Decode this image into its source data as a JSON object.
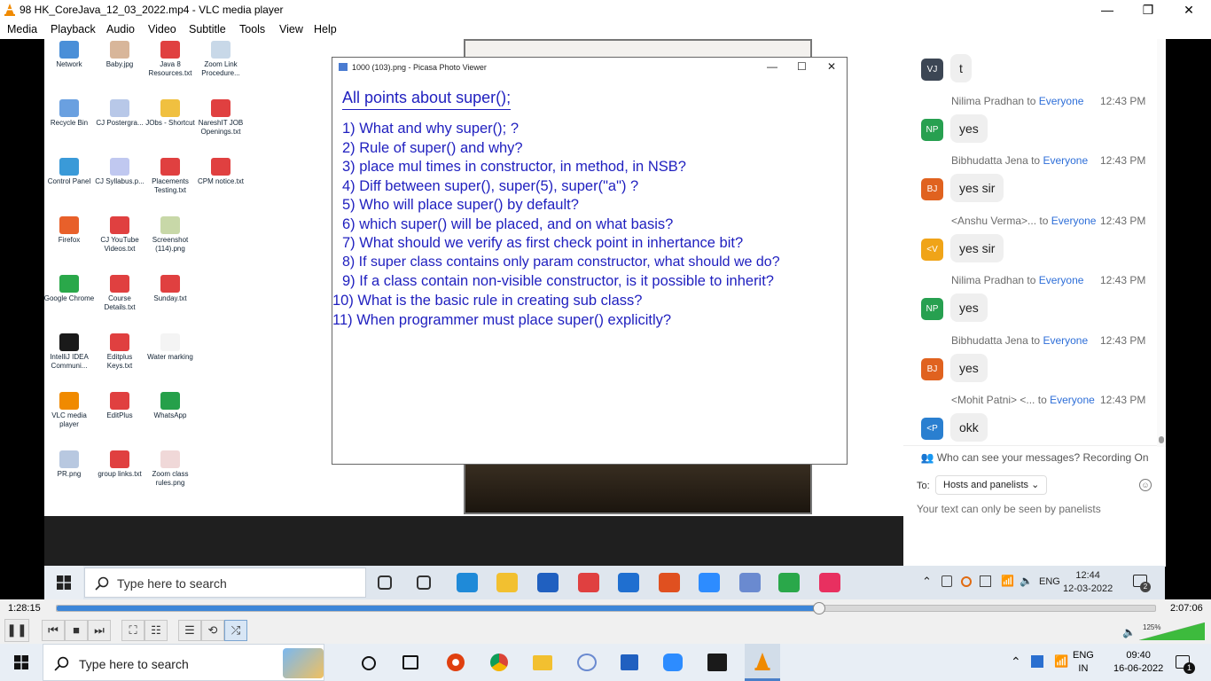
{
  "window": {
    "title": "98 HK_CoreJava_12_03_2022.mp4 - VLC media player",
    "controls": {
      "minimize": "—",
      "restore": "❐",
      "close": "✕"
    }
  },
  "menu": [
    "Media",
    "Playback",
    "Audio",
    "Video",
    "Subtitle",
    "Tools",
    "View",
    "Help"
  ],
  "desktop_icons": [
    {
      "label": "Network",
      "color": "#4a8fd8"
    },
    {
      "label": "Baby.jpg",
      "color": "#d8b69a"
    },
    {
      "label": "Java 8 Resources.txt",
      "color": "#e04040"
    },
    {
      "label": "Zoom Link Procedure...",
      "color": "#c8d8e8"
    },
    {
      "label": "Recycle Bin",
      "color": "#6aa0e0"
    },
    {
      "label": "CJ Postergra...",
      "color": "#b8c8e8"
    },
    {
      "label": "JObs - Shortcut",
      "color": "#f0c040"
    },
    {
      "label": "NareshIT JOB Openings.txt",
      "color": "#e04040"
    },
    {
      "label": "Control Panel",
      "color": "#3a9ad8"
    },
    {
      "label": "CJ Syllabus.p...",
      "color": "#c0c8f0"
    },
    {
      "label": "Placements Testing.txt",
      "color": "#e04040"
    },
    {
      "label": "CPM notice.txt",
      "color": "#e04040"
    },
    {
      "label": "Firefox",
      "color": "#e8602a"
    },
    {
      "label": "CJ YouTube Videos.txt",
      "color": "#e04040"
    },
    {
      "label": "Screenshot (114).png",
      "color": "#c8d8a8"
    },
    {
      "label": "",
      "color": "#ffffff"
    },
    {
      "label": "Google Chrome",
      "color": "#2aa84a"
    },
    {
      "label": "Course Details.txt",
      "color": "#e04040"
    },
    {
      "label": "Sunday.txt",
      "color": "#e04040"
    },
    {
      "label": "",
      "color": "#ffffff"
    },
    {
      "label": "IntelliJ IDEA Communi...",
      "color": "#1a1a1a"
    },
    {
      "label": "Editplus Keys.txt",
      "color": "#e04040"
    },
    {
      "label": "Water marking",
      "color": "#f4f4f4"
    },
    {
      "label": "",
      "color": "#ffffff"
    },
    {
      "label": "VLC media player",
      "color": "#f08a00"
    },
    {
      "label": "EditPlus",
      "color": "#e04040"
    },
    {
      "label": "WhatsApp",
      "color": "#25a04a"
    },
    {
      "label": "",
      "color": "#ffffff"
    },
    {
      "label": "PR.png",
      "color": "#b8c8e0"
    },
    {
      "label": "group links.txt",
      "color": "#e04040"
    },
    {
      "label": "Zoom class rules.png",
      "color": "#f0d8d8"
    }
  ],
  "picasa": {
    "title": "1000 (103).png - Picasa Photo Viewer",
    "heading": "All points about super();",
    "points": [
      "1) What and why super(); ?",
      "2) Rule of super() and why?",
      "3) place mul times in constructor, in method, in NSB?",
      "4) Diff between super(), super(5), super(\"a\") ?",
      "5) Who will place super() by default?",
      "6) which super() will be placed, and on what basis?",
      "7) What should we verify as first check point in inhertance bit?",
      "8) If super class contains only param constructor, what should we do?",
      "9) If a class contain non-visible constructor, is it possible to inherit?",
      "10) What is the basic rule in creating sub class?",
      "11) When programmer must place super() explicitly?"
    ]
  },
  "chat": {
    "messages": [
      {
        "initials": "VJ",
        "color": "#3c4654",
        "sender": "",
        "to": "",
        "target": "",
        "time": "",
        "text": "t"
      },
      {
        "initials": "NP",
        "color": "#27a050",
        "sender": "Nilima Pradhan",
        "to": "to",
        "target": "Everyone",
        "time": "12:43 PM",
        "text": "yes"
      },
      {
        "initials": "BJ",
        "color": "#e0621f",
        "sender": "Bibhudatta Jena",
        "to": "to",
        "target": "Everyone",
        "time": "12:43 PM",
        "text": "yes sir"
      },
      {
        "initials": "<V",
        "color": "#f0a418",
        "sender": "<Anshu Verma>...",
        "to": "to",
        "target": "Everyone",
        "time": "12:43 PM",
        "text": "yes sir"
      },
      {
        "initials": "NP",
        "color": "#27a050",
        "sender": "Nilima Pradhan",
        "to": "to",
        "target": "Everyone",
        "time": "12:43 PM",
        "text": "yes"
      },
      {
        "initials": "BJ",
        "color": "#e0621f",
        "sender": "Bibhudatta Jena",
        "to": "to",
        "target": "Everyone",
        "time": "12:43 PM",
        "text": "yes"
      },
      {
        "initials": "<P",
        "color": "#2a7fd0",
        "sender": "<Mohit Patni> <...",
        "to": "to",
        "target": "Everyone",
        "time": "12:43 PM",
        "text": "okk"
      }
    ],
    "who_can_see": "Who can see your messages? Recording On",
    "to_label": "To:",
    "to_value": "Hosts and panelists",
    "hint": "Your text can only be seen by panelists"
  },
  "inner_taskbar": {
    "search_placeholder": "Type here to search",
    "lang": "ENG",
    "time": "12:44",
    "date": "12-03-2022",
    "notif_count": "2",
    "apps": [
      {
        "name": "task-view-icon",
        "color": "#333333"
      },
      {
        "name": "widgets-icon",
        "color": "#333333"
      },
      {
        "name": "edge-icon",
        "color": "#1f8ad8"
      },
      {
        "name": "file-explorer-icon",
        "color": "#f2c030"
      },
      {
        "name": "store-icon",
        "color": "#2060c0"
      },
      {
        "name": "gift-icon",
        "color": "#e04040"
      },
      {
        "name": "mail-icon",
        "color": "#1f6fd0"
      },
      {
        "name": "record-icon",
        "color": "#e05020"
      },
      {
        "name": "zoom-icon",
        "color": "#2d8cff"
      },
      {
        "name": "snip-icon",
        "color": "#6a8ad0"
      },
      {
        "name": "chrome-icon",
        "color": "#2aa84a"
      },
      {
        "name": "camera-app-icon",
        "color": "#e83060"
      }
    ]
  },
  "player": {
    "current_time": "1:28:15",
    "total_time": "2:07:06",
    "progress": 0.694,
    "volume": "125%",
    "volume_level": 1.25
  },
  "host_taskbar": {
    "search_placeholder": "Type here to search",
    "lang_top": "ENG",
    "lang_bottom": "IN",
    "time": "09:40",
    "date": "16-06-2022",
    "notif_count": "1"
  }
}
